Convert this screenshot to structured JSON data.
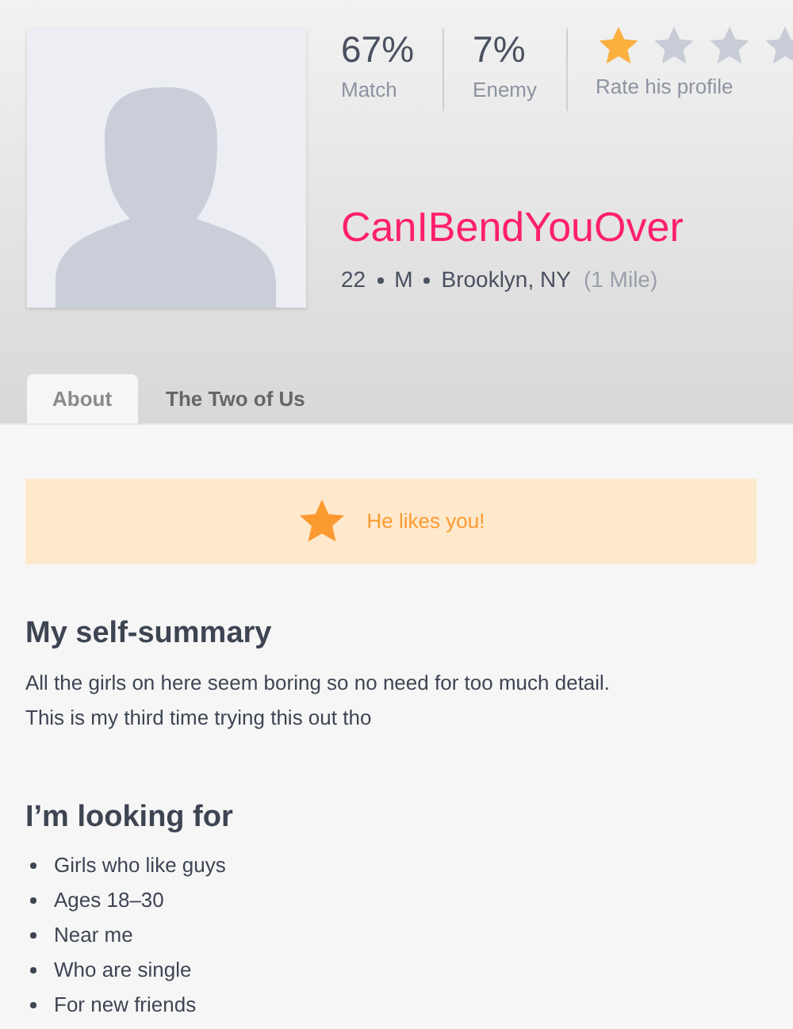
{
  "profile": {
    "stats": [
      {
        "value": "67%",
        "label": "Match"
      },
      {
        "value": "7%",
        "label": "Enemy"
      }
    ],
    "rating": {
      "label": "Rate his profile",
      "stars": 1
    },
    "username": "CanIBendYouOver",
    "details": [
      "22",
      "M",
      "Brooklyn, NY"
    ],
    "distance": "(1 Mile)"
  },
  "tabs": [
    {
      "label": "About",
      "selected": true
    },
    {
      "label": "The Two of Us",
      "selected": false
    }
  ],
  "banner": {
    "text": "He likes you!"
  },
  "sections": [
    {
      "kind": "text",
      "title": "My self-summary",
      "body": [
        "All the girls on here seem boring so no need for too much detail.",
        "This is my third time trying this out tho"
      ]
    },
    {
      "kind": "list",
      "title": "I’m looking for",
      "items": [
        "Girls who like guys",
        "Ages 18–30",
        "Near me",
        "Who are single",
        "For new friends"
      ]
    }
  ]
}
